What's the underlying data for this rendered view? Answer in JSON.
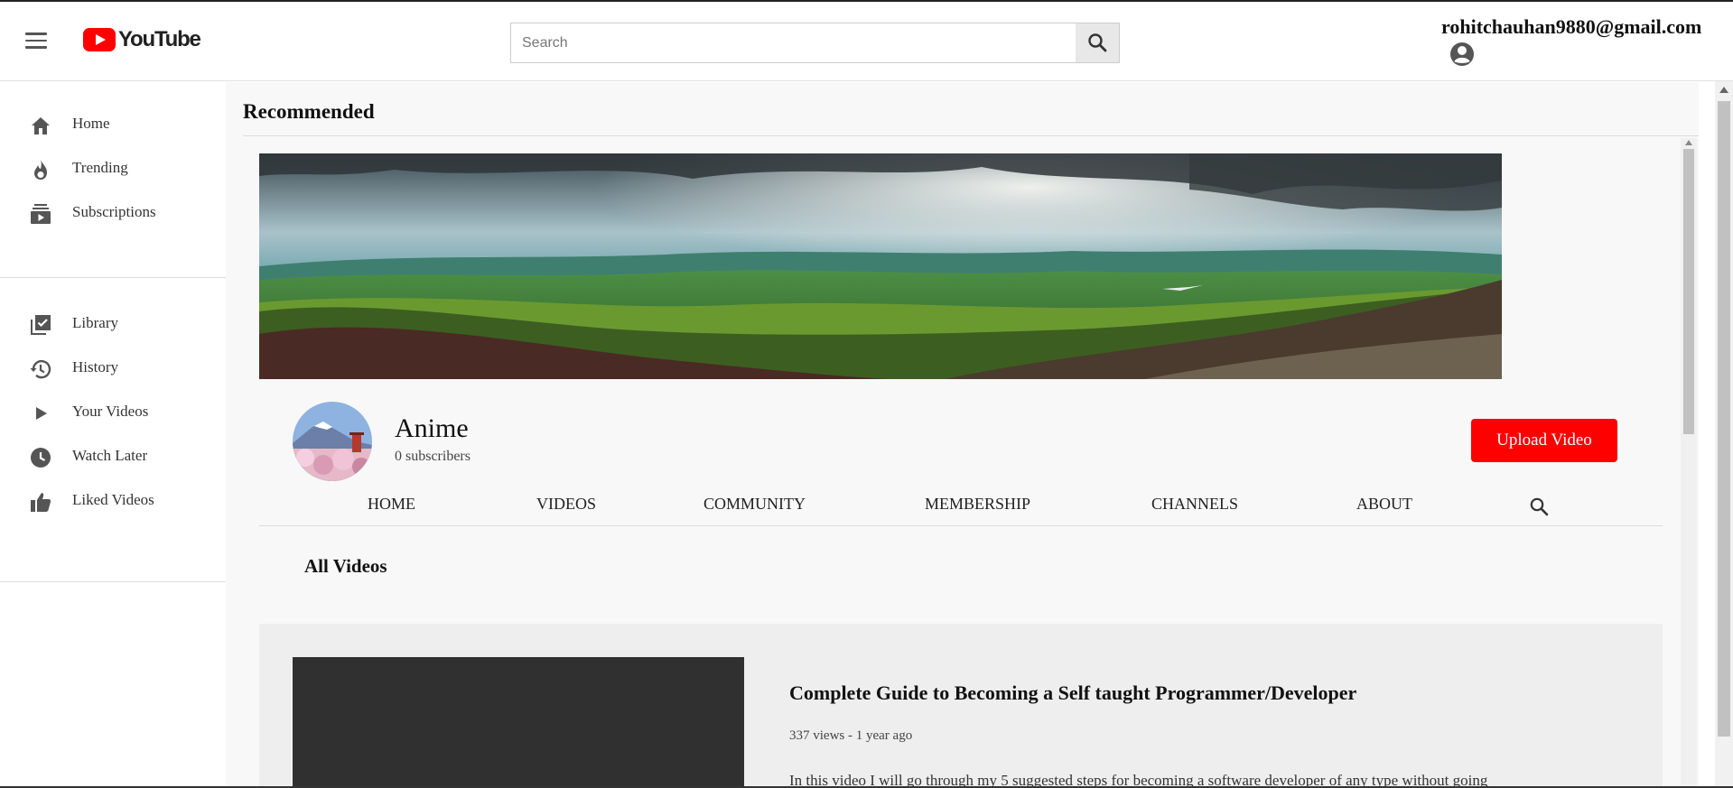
{
  "header": {
    "logo_text": "YouTube",
    "search_placeholder": "Search",
    "account_email": "rohitchauhan9880@gmail.com",
    "icons": {
      "menu": "hamburger-menu-icon",
      "search": "search-icon",
      "account": "account-circle-icon"
    }
  },
  "sidebar": {
    "items": [
      {
        "label": "Home",
        "icon": "home-icon"
      },
      {
        "label": "Trending",
        "icon": "flame-icon"
      },
      {
        "label": "Subscriptions",
        "icon": "subscriptions-icon"
      },
      {
        "label": "Library",
        "icon": "library-icon"
      },
      {
        "label": "History",
        "icon": "history-icon"
      },
      {
        "label": "Your Videos",
        "icon": "play-icon"
      },
      {
        "label": "Watch Later",
        "icon": "clock-icon"
      },
      {
        "label": "Liked Videos",
        "icon": "thumbs-up-icon"
      }
    ]
  },
  "main": {
    "title": "Recommended",
    "channel": {
      "name": "Anime",
      "subscribers": "0 subscribers",
      "upload_label": "Upload Video"
    },
    "tabs": [
      "HOME",
      "VIDEOS",
      "COMMUNITY",
      "MEMBERSHIP",
      "CHANNELS",
      "ABOUT"
    ],
    "section_title": "All Videos",
    "videos": [
      {
        "title": "Complete Guide to Becoming a Self taught Programmer/Developer",
        "meta": "337 views - 1 year ago",
        "description": "In this video I will go through my 5 suggested steps for becoming a software developer of any type without going"
      }
    ]
  },
  "colors": {
    "brand_red": "#ff0000",
    "thumbnail_dark": "#303030",
    "card_bg": "#eeeeee",
    "main_bg": "#f8f8f8"
  }
}
